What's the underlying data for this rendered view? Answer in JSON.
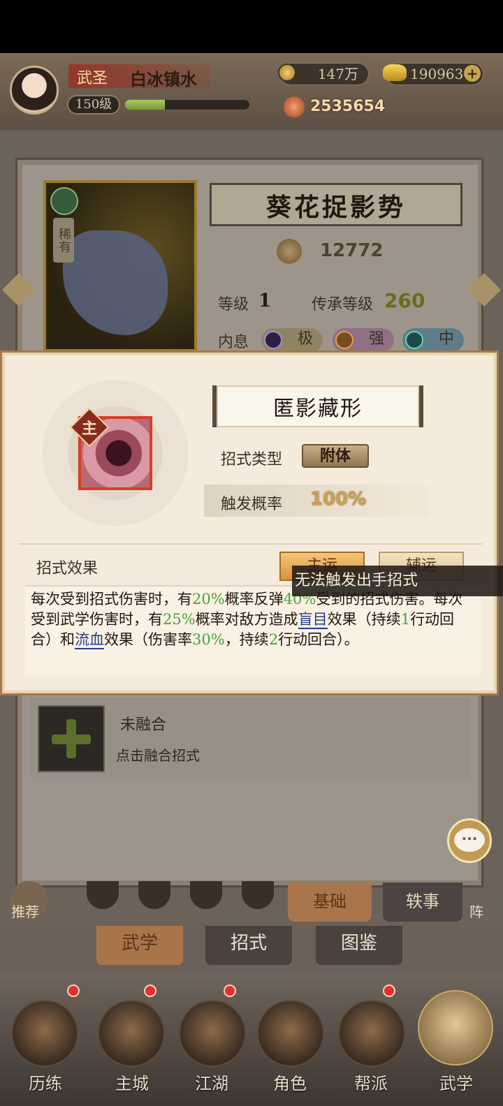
{
  "header": {
    "rank": "武圣",
    "player_name": "白冰镇水",
    "level": "150级",
    "exp_fraction": 0.32,
    "coins": "147万",
    "gold": "190963",
    "power": "2535654"
  },
  "skill_panel": {
    "rarity": "稀有",
    "skill_name": "葵花捉影势",
    "skill_power": "12772",
    "level_label": "等级",
    "level_value": "1",
    "inherit_label": "传承等级",
    "inherit_value": "260",
    "neixi_label": "内息",
    "neixi": [
      "极",
      "强",
      "中"
    ]
  },
  "fusion": {
    "title": "未融合",
    "hint": "点击融合招式"
  },
  "popup": {
    "badge": "主",
    "title": "匿影藏形",
    "type_label": "招式类型",
    "type_value": "附体",
    "rate_label": "触发概率",
    "rate_value": "100%",
    "effect_label": "招式效果",
    "btn_main": "主运",
    "btn_aux": "辅运",
    "tooltip": "无法触发出手招式",
    "effect_segments": [
      {
        "text": "每次受到招式伤害时，有",
        "style": "n"
      },
      {
        "text": "20%",
        "style": "g"
      },
      {
        "text": "概率反弹",
        "style": "n"
      },
      {
        "text": "40%",
        "style": "g"
      },
      {
        "text": "受到的招式伤害。每次受到武学伤害时，有",
        "style": "n"
      },
      {
        "text": "25%",
        "style": "g"
      },
      {
        "text": "概率对敌方造成",
        "style": "n"
      },
      {
        "text": "盲目",
        "style": "b"
      },
      {
        "text": "效果（持续",
        "style": "n"
      },
      {
        "text": "1",
        "style": "g"
      },
      {
        "text": "行动回合）和",
        "style": "n"
      },
      {
        "text": "流血",
        "style": "b"
      },
      {
        "text": "效果（伤害率",
        "style": "n"
      },
      {
        "text": "30%",
        "style": "g"
      },
      {
        "text": "，持续",
        "style": "n"
      },
      {
        "text": "2",
        "style": "g"
      },
      {
        "text": "行动回合）。",
        "style": "n"
      }
    ]
  },
  "sub_tabs": {
    "recommend": "推荐",
    "basic": "基础",
    "anecdote": "轶事",
    "right_edge": "阵"
  },
  "main_tabs": [
    "武学",
    "招式",
    "图鉴"
  ],
  "bottom_nav": [
    "历练",
    "主城",
    "江湖",
    "角色",
    "帮派",
    "武学"
  ],
  "colors": {
    "accent_green": "#4aa33a",
    "link_blue": "#243c86",
    "icon_border_red": "#d53e2a"
  }
}
